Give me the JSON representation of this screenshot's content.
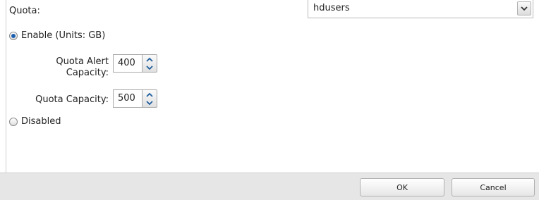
{
  "quota": {
    "heading": "Quota:",
    "group_select_value": "hdusers",
    "enable_label": "Enable (Units: GB)",
    "disabled_label": "Disabled",
    "alert_label_line1": "Quota Alert",
    "alert_label_line2": "Capacity:",
    "alert_value": "400",
    "capacity_label": "Quota Capacity:",
    "capacity_value": "500",
    "selected_option": "enable"
  },
  "footer": {
    "ok_label": "OK",
    "cancel_label": "Cancel"
  },
  "colors": {
    "radio_selected": "#1c5fae",
    "footer_background": "#e6e6e6"
  },
  "icons": {
    "select_arrow": "chevron-down-icon",
    "stepper_up": "chevron-up-icon",
    "stepper_down": "chevron-down-icon"
  }
}
